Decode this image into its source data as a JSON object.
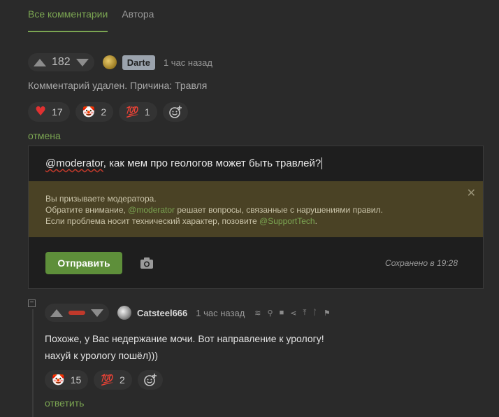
{
  "tabs": [
    {
      "label": "Все комментарии",
      "active": true
    },
    {
      "label": "Автора",
      "active": false
    }
  ],
  "comment1": {
    "rating": "182",
    "author": "Darte",
    "time": "1 час назад",
    "text": "Комментарий удален. Причина: Травля",
    "reactions": [
      {
        "icon": "heart-icon",
        "glyph": "♥",
        "count": "17"
      },
      {
        "icon": "clown-icon",
        "glyph": "🤡",
        "count": "2"
      },
      {
        "icon": "hundred-icon",
        "glyph": "💯",
        "count": "1"
      }
    ]
  },
  "cancel_label": "отмена",
  "editor": {
    "mention": "@moderator",
    "text": ",  как мем про геологов может быть травлей?",
    "notice_line1": "Вы призываете модератора.",
    "notice_line2_pre": "Обратите внимание, ",
    "notice_line2_mention": "@moderator",
    "notice_line2_post": " решает вопросы, связанные с нарушениями правил.",
    "notice_line3_pre": "Если проблема носит технический характер, позовите ",
    "notice_line3_mention": "@SupportTech",
    "notice_line3_post": ".",
    "submit_label": "Отправить",
    "saved_text": "Сохранено в 19:28"
  },
  "comment2": {
    "author": "Catsteel666",
    "time": "1 час назад",
    "line1": "Похоже, у Вас недержание мочи. Вот направление к урологу!",
    "line2": "нахуй к урологу пошёл)))",
    "reactions": [
      {
        "icon": "clown-icon",
        "glyph": "🤡",
        "count": "15"
      },
      {
        "icon": "hundred-icon",
        "glyph": "💯",
        "count": "2"
      }
    ],
    "reply_label": "ответить"
  },
  "colors": {
    "accent": "#7ba552",
    "background": "#2a2a2a",
    "notice_bg": "#4a4225",
    "downvote": "#c0392b"
  }
}
